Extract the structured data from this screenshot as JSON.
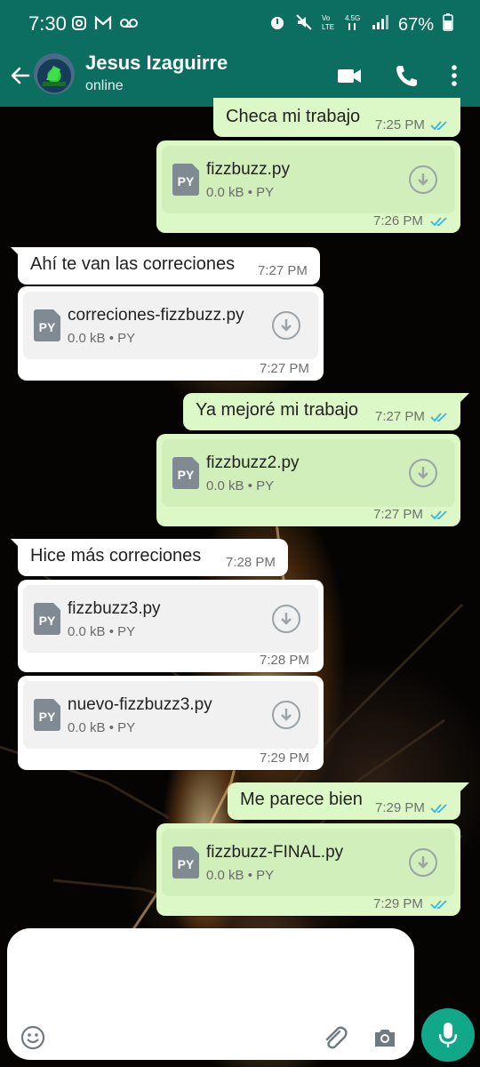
{
  "status_bar": {
    "time": "7:30",
    "battery": "67%"
  },
  "header": {
    "contact_name": "Jesus Izaguirre",
    "contact_status": "online"
  },
  "messages": [
    {
      "type": "text",
      "text": "Checa mi trabajo",
      "time": "7:25 PM"
    },
    {
      "type": "file",
      "file_name": "fizzbuzz.py",
      "size": "0.0 kB",
      "ext": "PY",
      "time": "7:26 PM"
    },
    {
      "type": "text",
      "text": "Ahí te van las correciones",
      "time": "7:27 PM"
    },
    {
      "type": "file",
      "file_name": "correciones-fizzbuzz.py",
      "size": "0.0 kB",
      "ext": "PY",
      "time": "7:27 PM"
    },
    {
      "type": "text",
      "text": "Ya mejoré mi trabajo",
      "time": "7:27 PM"
    },
    {
      "type": "file",
      "file_name": "fizzbuzz2.py",
      "size": "0.0 kB",
      "ext": "PY",
      "time": "7:27 PM"
    },
    {
      "type": "text",
      "text": "Hice más correciones",
      "time": "7:28 PM"
    },
    {
      "type": "file",
      "file_name": "fizzbuzz3.py",
      "size": "0.0 kB",
      "ext": "PY",
      "time": "7:28 PM"
    },
    {
      "type": "file",
      "file_name": "nuevo-fizzbuzz3.py",
      "size": "0.0 kB",
      "ext": "PY",
      "time": "7:29 PM"
    },
    {
      "type": "text",
      "text": "Me parece bien",
      "time": "7:29 PM"
    },
    {
      "type": "file",
      "file_name": "fizzbuzz-FINAL.py",
      "size": "0.0 kB",
      "ext": "PY",
      "time": "7:29 PM"
    }
  ],
  "separator": "•",
  "colors": {
    "header": "#0b6e60",
    "outgoing_bubble": "#dcf8c6",
    "incoming_bubble": "#ffffff",
    "read_ticks": "#34b7f1",
    "mic_button": "#11a889"
  },
  "icons": {
    "back": "back-arrow-icon",
    "video": "video-call-icon",
    "phone": "phone-call-icon",
    "menu": "more-vert-icon",
    "emoji": "emoji-icon",
    "attach": "paperclip-icon",
    "camera": "camera-icon",
    "mic": "mic-icon"
  }
}
